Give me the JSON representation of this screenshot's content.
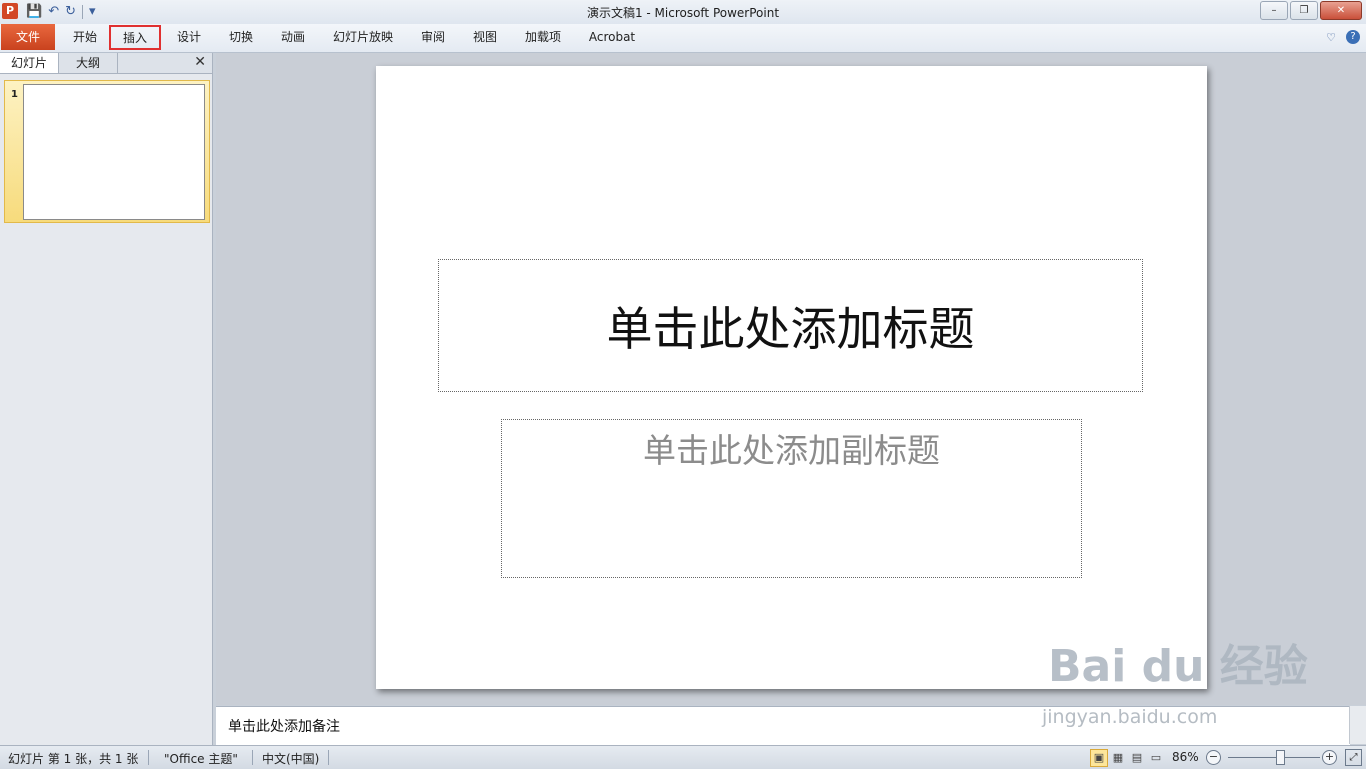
{
  "window": {
    "title": "演示文稿1  -  Microsoft PowerPoint",
    "app_icon": "P",
    "minimize": "–",
    "restore": "❐",
    "close": "✕"
  },
  "qat": {
    "save": "💾",
    "undo": "↶",
    "redo": "↻",
    "more": "▾"
  },
  "ribbon": {
    "tabs": [
      "文件",
      "开始",
      "插入",
      "设计",
      "切换",
      "动画",
      "幻灯片放映",
      "审阅",
      "视图",
      "加载项",
      "Acrobat"
    ],
    "collapse": "♡",
    "help": "?"
  },
  "left_panel": {
    "tabs": [
      "幻灯片",
      "大纲"
    ],
    "close": "✕",
    "slide_number": "1"
  },
  "slide": {
    "title_placeholder": "单击此处添加标题",
    "subtitle_placeholder": "单击此处添加副标题"
  },
  "notes": {
    "placeholder": "单击此处添加备注"
  },
  "status": {
    "slide_info": "幻灯片 第 1 张，共 1 张",
    "theme": "\"Office 主题\"",
    "language": "中文(中国)",
    "zoom": "86%",
    "zoom_minus": "−",
    "zoom_plus": "+",
    "views": [
      "▣",
      "▦",
      "▤",
      "▭"
    ],
    "fit": "⤢",
    "zoom_level_fraction": 0.56
  },
  "watermark": {
    "brand": "Bai du 经验",
    "url": "jingyan.baidu.com"
  }
}
